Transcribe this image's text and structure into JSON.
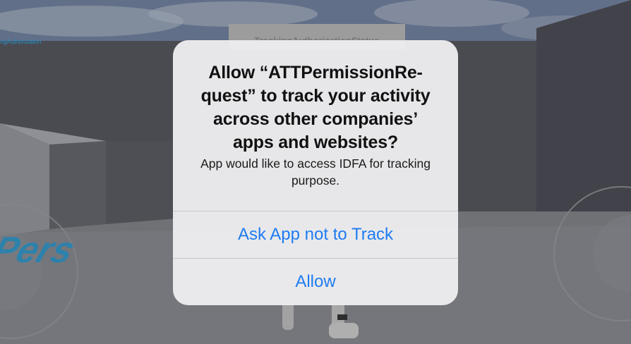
{
  "background": {
    "debug_label": "ngAuthorization",
    "panel_label": "TrackingAuthorizationStatus",
    "floor_text": "Pers",
    "colors": {
      "sky": "#8a9ab8",
      "wall": "#6a6c75",
      "floor": "#8c8e94",
      "debug_text": "#37b3f4"
    }
  },
  "alert": {
    "title": "Allow “ATTPermissionRe-quest” to track your activity across other companies’ apps and websites?",
    "message": "App would like to access IDFA for tracking purpose.",
    "buttons": {
      "ask_not_to_track": "Ask App not to Track",
      "allow": "Allow"
    },
    "colors": {
      "background": "#ececee",
      "button_text": "#1f7cf2",
      "divider": "#c6c6c8"
    }
  }
}
